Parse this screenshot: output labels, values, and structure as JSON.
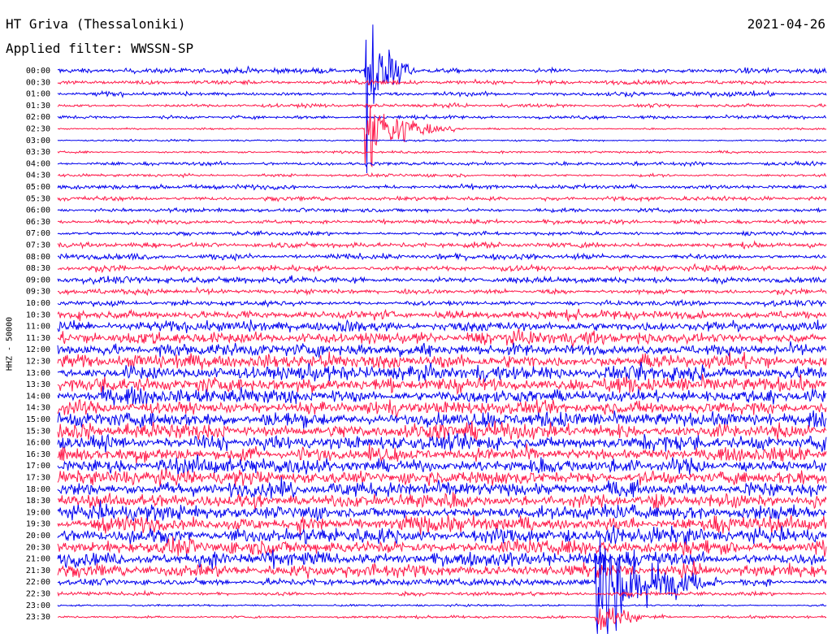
{
  "header": {
    "station": "HT Griva (Thessaloniki)",
    "filter": "Applied filter: WWSSN-SP",
    "date": "2021-04-26"
  },
  "channel_label": "HHZ - 50000",
  "colors": {
    "blue": "#0000ee",
    "red": "#ff1a4a",
    "background": "#ffffff"
  },
  "chart_data": {
    "type": "helicorder",
    "title": "HT Griva (Thessaloniki)",
    "subtitle": "Applied filter: WWSSN-SP",
    "date": "2021-04-26",
    "ylabel": "HHZ - 50000",
    "trace_colors_alternate": [
      "blue",
      "red"
    ],
    "rows": [
      {
        "time": "00:00",
        "noise": 0.55
      },
      {
        "time": "00:30",
        "noise": 0.45
      },
      {
        "time": "01:00",
        "noise": 0.45
      },
      {
        "time": "01:30",
        "noise": 0.35
      },
      {
        "time": "02:00",
        "noise": 0.35
      },
      {
        "time": "02:30",
        "noise": 0.2
      },
      {
        "time": "03:00",
        "noise": 0.2
      },
      {
        "time": "03:30",
        "noise": 0.25
      },
      {
        "time": "04:00",
        "noise": 0.35
      },
      {
        "time": "04:30",
        "noise": 0.3
      },
      {
        "time": "05:00",
        "noise": 0.45
      },
      {
        "time": "05:30",
        "noise": 0.45
      },
      {
        "time": "06:00",
        "noise": 0.4
      },
      {
        "time": "06:30",
        "noise": 0.45
      },
      {
        "time": "07:00",
        "noise": 0.4
      },
      {
        "time": "07:30",
        "noise": 0.55
      },
      {
        "time": "08:00",
        "noise": 0.55
      },
      {
        "time": "08:30",
        "noise": 0.6
      },
      {
        "time": "09:00",
        "noise": 0.65
      },
      {
        "time": "09:30",
        "noise": 0.55
      },
      {
        "time": "10:00",
        "noise": 0.6
      },
      {
        "time": "10:30",
        "noise": 0.9
      },
      {
        "time": "11:00",
        "noise": 1.1
      },
      {
        "time": "11:30",
        "noise": 1.3
      },
      {
        "time": "12:00",
        "noise": 1.4
      },
      {
        "time": "12:30",
        "noise": 1.5
      },
      {
        "time": "13:00",
        "noise": 1.6
      },
      {
        "time": "13:30",
        "noise": 1.6
      },
      {
        "time": "14:00",
        "noise": 1.6
      },
      {
        "time": "14:30",
        "noise": 1.5
      },
      {
        "time": "15:00",
        "noise": 1.6
      },
      {
        "time": "15:30",
        "noise": 1.6
      },
      {
        "time": "16:00",
        "noise": 1.5
      },
      {
        "time": "16:30",
        "noise": 1.5
      },
      {
        "time": "17:00",
        "noise": 1.6
      },
      {
        "time": "17:30",
        "noise": 1.6
      },
      {
        "time": "18:00",
        "noise": 1.6
      },
      {
        "time": "18:30",
        "noise": 1.6
      },
      {
        "time": "19:00",
        "noise": 1.6
      },
      {
        "time": "19:30",
        "noise": 1.6
      },
      {
        "time": "20:00",
        "noise": 1.6
      },
      {
        "time": "20:30",
        "noise": 1.5
      },
      {
        "time": "21:00",
        "noise": 1.4
      },
      {
        "time": "21:30",
        "noise": 1.3
      },
      {
        "time": "22:00",
        "noise": 0.7
      },
      {
        "time": "22:30",
        "noise": 0.4
      },
      {
        "time": "23:00",
        "noise": 0.2
      },
      {
        "time": "23:30",
        "noise": 0.25
      }
    ],
    "events": [
      {
        "time": "00:00",
        "minute": 12.0,
        "amplitude": 6.0,
        "duration": 2.0
      },
      {
        "time": "02:30",
        "minute": 12.0,
        "amplitude": 3.0,
        "duration": 3.5
      },
      {
        "time": "22:00",
        "minute": 21.0,
        "amplitude": 5.0,
        "duration": 5.0
      },
      {
        "time": "23:30",
        "minute": 21.0,
        "amplitude": 1.2,
        "duration": 3.0
      }
    ]
  }
}
